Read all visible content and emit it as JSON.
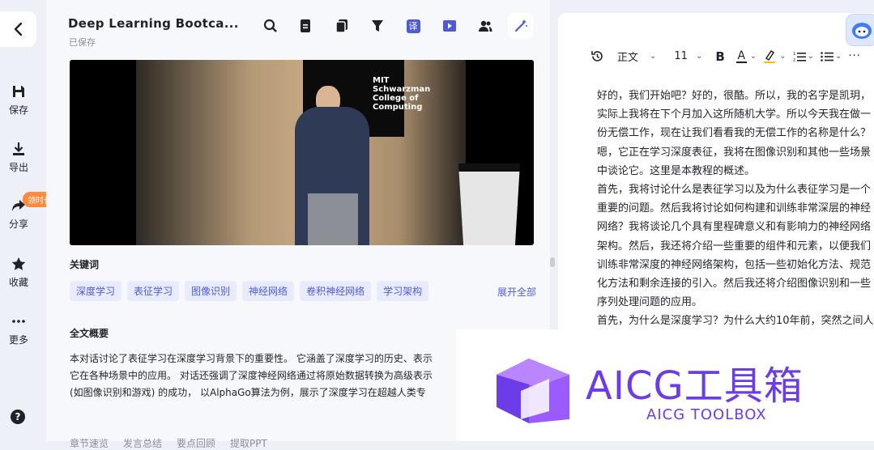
{
  "sidebar": {
    "items": [
      {
        "label": "保存",
        "icon": "save-icon"
      },
      {
        "label": "导出",
        "icon": "download-icon"
      },
      {
        "label": "分享",
        "icon": "share-icon"
      },
      {
        "label": "收藏",
        "icon": "star-icon"
      },
      {
        "label": "更多",
        "icon": "more-icon"
      }
    ],
    "promo_badge": "领时长",
    "help_glyph": "?"
  },
  "header": {
    "title": "Deep Learning Bootca...",
    "status": "已保存",
    "toolbar_icons": [
      "search-icon",
      "document-icon",
      "copy-icon",
      "filter-icon",
      "translate-icon",
      "play-icon",
      "users-icon",
      "magic-wand-icon"
    ],
    "translate_glyph": "译"
  },
  "video": {
    "logo_lines": [
      "MIT",
      "Schwarzman",
      "College of",
      "Computing"
    ]
  },
  "keywords": {
    "label": "关键词",
    "tags": [
      "深度学习",
      "表征学习",
      "图像识别",
      "神经网络",
      "卷积神经网络",
      "学习架构"
    ],
    "expand": "展开全部"
  },
  "summary": {
    "label": "全文概要",
    "lines": [
      "本对话讨论了表征学习在深度学习背景下的重要性。 它涵盖了深度学习的历史、表示",
      "它在各种场景中的应用。 对话还强调了深度神经网络通过将原始数据转换为高级表示",
      "(如图像识别和游戏) 的成功， 以AlphaGo算法为例，展示了深度学习在超越人类专"
    ]
  },
  "bottom_tabs": [
    "章节速览",
    "发言总结",
    "要点回顾",
    "提取PPT"
  ],
  "editor": {
    "toolbar": {
      "style": "正文",
      "font_size": "11",
      "bold": "B",
      "font_color": "A"
    },
    "lines": [
      "好的，我们开始吧？好的，很酷。所以，我的名字是凯玥，",
      "实际上我将在下个月加入这所随机大学。所以今天我在做一",
      "份无偿工作，现在让我们看看我的无偿工作的名称是什么？",
      "嗯，它正在学习深度表征，我将在图像识别和其他一些场景",
      "中谈论它。这里是本教程的概述。",
      "首先，我将讨论什么是表征学习以及为什么表征学习是一个",
      "重要的问题。然后我将讨论如何构建和训练非常深层的神经",
      "网络？我将谈论几个具有里程碑意义和有影响力的神经网络",
      "架构。然后，我还将介绍一些重要的组件和元素，以便我们",
      "训练非常深度的神经网络架构，包括一些初始化方法、规范",
      "化方法和剩余连接的引入。然后我还将介绍图像识别和一些",
      "序列处理问题的应用。",
      "首先，为什么是深度学习？为什么大约10年前，突然之间人"
    ]
  },
  "watermark": {
    "title": "AICG工具箱",
    "subtitle": "AICG TOOLBOX"
  },
  "colors": {
    "accent": "#4f5bd5",
    "tag_bg": "#e8ebfb",
    "promo": "#ff8a3d",
    "watermark": "#6c3ce8"
  }
}
